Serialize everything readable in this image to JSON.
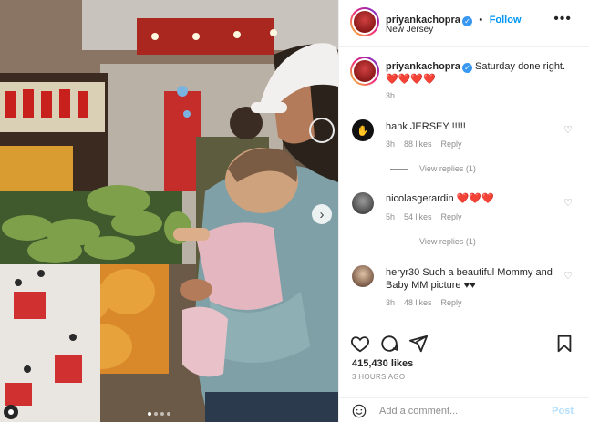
{
  "post": {
    "author": "priyankachopra",
    "follow_label": "Follow",
    "location": "New Jersey",
    "more_label": "•••",
    "caption": "Saturday done right. ❤️❤️❤️❤️",
    "caption_time": "3h",
    "likes": "415,430 likes",
    "time_ago": "3 HOURS AGO"
  },
  "comments": [
    {
      "user": "hank",
      "text": "JERSEY !!!!!",
      "time": "3h",
      "likes": "88 likes",
      "reply": "Reply",
      "view_replies": "View replies (1)"
    },
    {
      "user": "nicolasgerardin",
      "text": "❤️❤️❤️",
      "time": "5h",
      "likes": "54 likes",
      "reply": "Reply",
      "view_replies": "View replies (1)"
    },
    {
      "user": "heryr30",
      "text": "Such a beautiful Mommy and Baby MM picture ♥♥",
      "time": "3h",
      "likes": "48 likes",
      "reply": "Reply"
    }
  ],
  "add_comment": {
    "placeholder": "Add a comment...",
    "post_label": "Post"
  },
  "carousel": {
    "next_icon": "›",
    "slide_count": 4,
    "active_slide": 1
  },
  "colors": {
    "accent": "#0095f6",
    "verified": "#3897f0",
    "text": "#262626",
    "muted": "#8e8e8e"
  }
}
